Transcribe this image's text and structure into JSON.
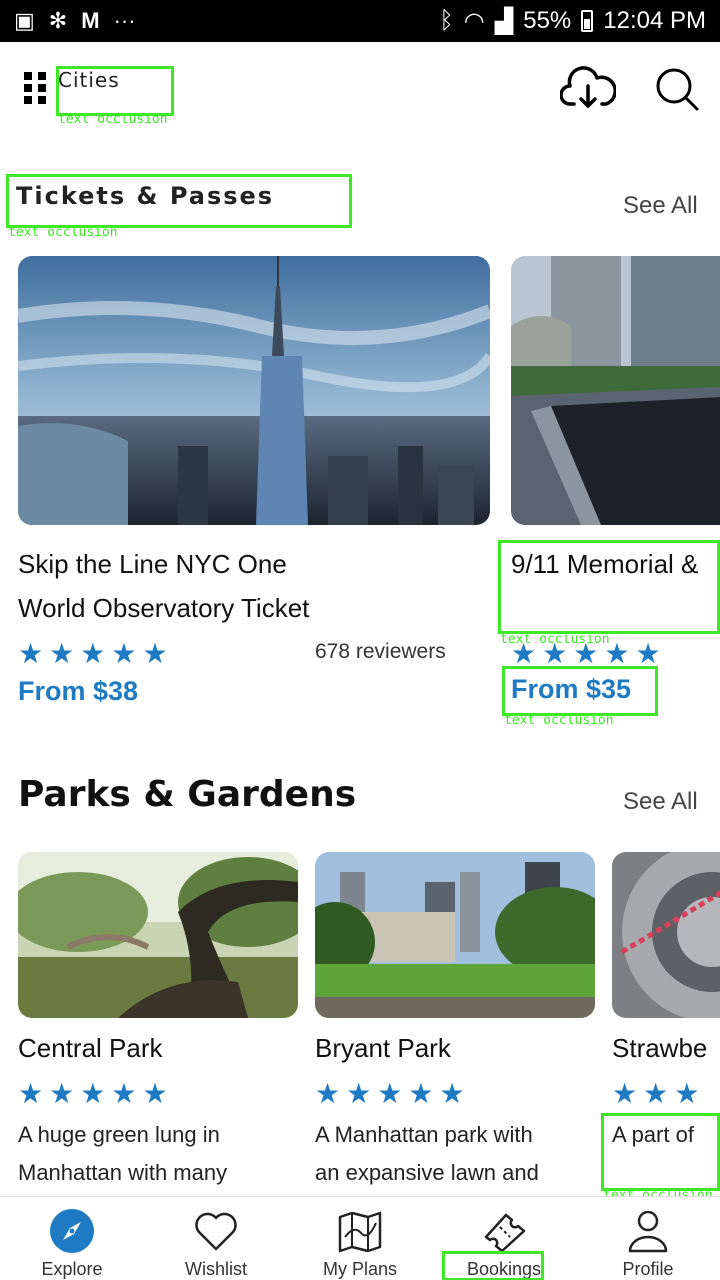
{
  "status_bar": {
    "battery": "55%",
    "time": "12:04 PM"
  },
  "header": {
    "title": "Cities",
    "occlusion_label": "text occlusion"
  },
  "tickets_section": {
    "title": "Tickets & Passes",
    "see_all": "See All",
    "occlusion_label": "text occlusion",
    "cards": [
      {
        "title_line1": "Skip the Line NYC One",
        "title_line2": "World Observatory Ticket",
        "rating": 5,
        "reviewers": "678 reviewers",
        "price": "From $38"
      },
      {
        "title_line1": "9/11 Memorial &",
        "rating": 5,
        "price": "From $35",
        "occlusion_label": "text occlusion"
      }
    ]
  },
  "parks_section": {
    "title": "Parks & Gardens",
    "see_all": "See All",
    "cards": [
      {
        "title": "Central Park",
        "rating": 5,
        "desc_line1": "A huge green lung in",
        "desc_line2": "Manhattan with many"
      },
      {
        "title": "Bryant Park",
        "rating": 5,
        "desc_line1": "A Manhattan park with",
        "desc_line2": "an expansive lawn and"
      },
      {
        "title": "Strawbe",
        "rating": 5,
        "desc_line1": "A part of",
        "occlusion_label": "text occlusion"
      }
    ]
  },
  "bottom_nav": {
    "items": [
      {
        "label": "Explore",
        "icon": "compass-icon"
      },
      {
        "label": "Wishlist",
        "icon": "heart-icon"
      },
      {
        "label": "My Plans",
        "icon": "map-icon"
      },
      {
        "label": "Bookings",
        "icon": "ticket-icon"
      },
      {
        "label": "Profile",
        "icon": "user-icon"
      }
    ],
    "active_color": "#1e7bc3"
  },
  "colors": {
    "accent": "#1e7bc3",
    "occlusion": "#3ee826"
  }
}
